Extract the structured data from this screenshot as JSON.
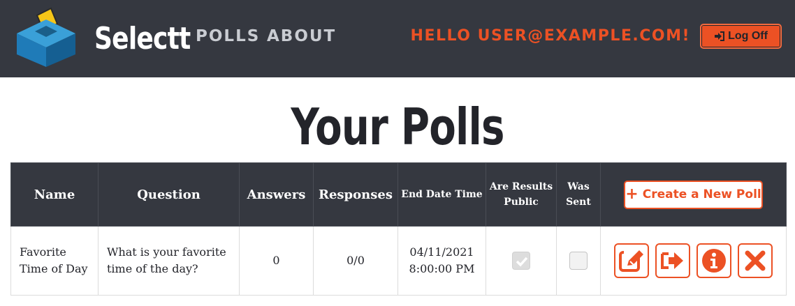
{
  "header": {
    "brand": "Selectt",
    "nav": [
      {
        "label": "POLLS"
      },
      {
        "label": "ABOUT"
      }
    ],
    "greeting": "HELLO USER@EXAMPLE.COM!",
    "logoff_label": "Log Off",
    "logoff_icon": "sign-out-icon"
  },
  "page": {
    "title": "Your Polls"
  },
  "table": {
    "columns": [
      {
        "label": "Name"
      },
      {
        "label": "Question"
      },
      {
        "label": "Answers"
      },
      {
        "label": "Responses"
      },
      {
        "label": "End Date Time"
      },
      {
        "label": "Are Results Public"
      },
      {
        "label": "Was Sent"
      }
    ],
    "create_label": "Create a New Poll",
    "rows": [
      {
        "name": "Favorite Time of Day",
        "question": "What is your favorite time of the day?",
        "answers": "0",
        "responses": "0/0",
        "end_date": "04/11/2021",
        "end_time": "8:00:00 PM",
        "results_public": true,
        "was_sent": false,
        "actions": [
          "edit-icon",
          "send-icon",
          "info-icon",
          "delete-icon"
        ]
      }
    ]
  },
  "colors": {
    "header_bg": "#353840",
    "accent": "#ec5124",
    "nav_text": "#c9ccd2",
    "text": "#23242a"
  }
}
